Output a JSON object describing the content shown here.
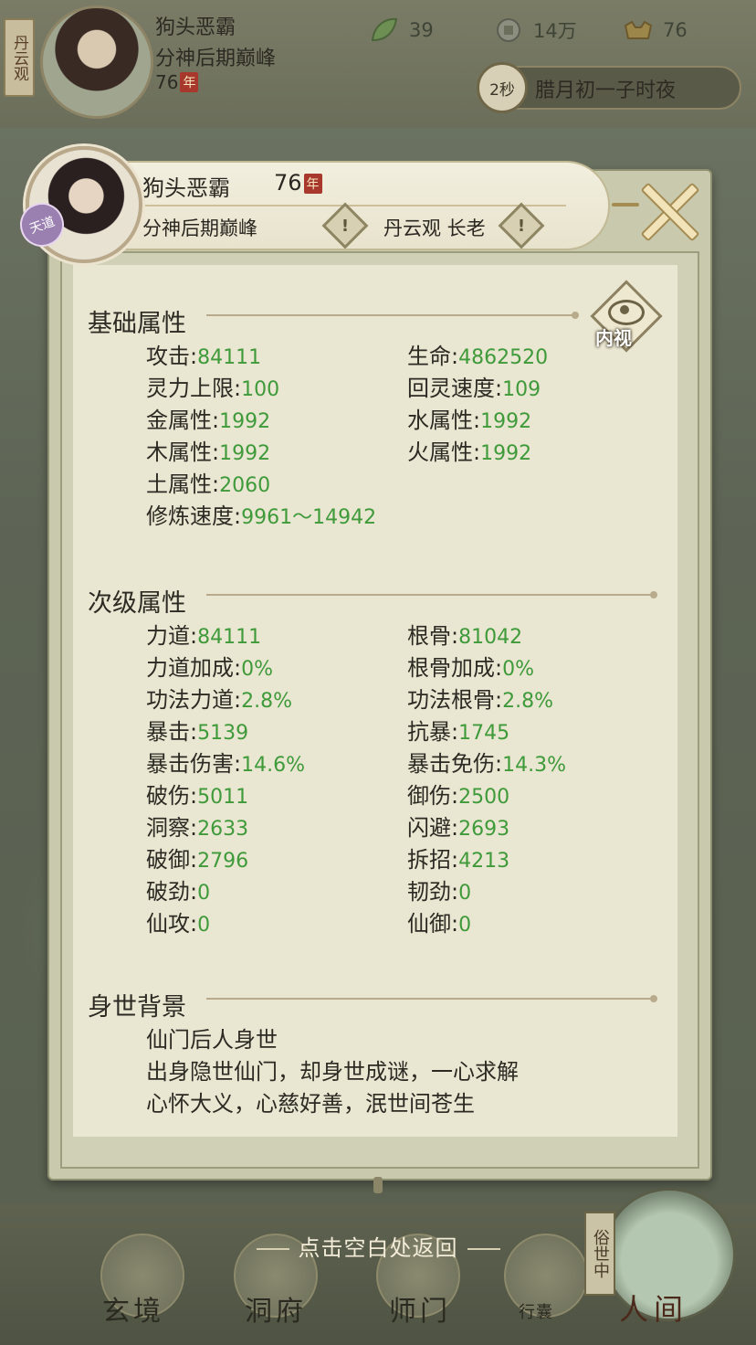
{
  "top": {
    "sect_tag": "丹云观",
    "name": "狗头恶霸",
    "realm": "分神后期巅峰",
    "age": "76",
    "age_unit": "年",
    "resources": {
      "spirit": "39",
      "coins": "14万",
      "strength": "76"
    },
    "timer": "2秒",
    "time_text": "腊月初一子时夜"
  },
  "header": {
    "name": "狗头恶霸",
    "age": "76",
    "age_unit": "年",
    "realm": "分神后期巅峰",
    "sect": "丹云观 长老",
    "avatar_tag": "天道",
    "eye_label": "内视"
  },
  "basic": {
    "title": "基础属性",
    "stats": [
      {
        "label": "攻击:",
        "value": "84111"
      },
      {
        "label": "生命:",
        "value": "4862520"
      },
      {
        "label": "灵力上限:",
        "value": "100"
      },
      {
        "label": "回灵速度:",
        "value": "109"
      },
      {
        "label": "金属性:",
        "value": "1992"
      },
      {
        "label": "水属性:",
        "value": "1992"
      },
      {
        "label": "木属性:",
        "value": "1992"
      },
      {
        "label": "火属性:",
        "value": "1992"
      },
      {
        "label": "土属性:",
        "value": "2060"
      },
      {
        "label": "修炼速度:",
        "value": "9961～14942"
      }
    ]
  },
  "secondary": {
    "title": "次级属性",
    "stats": [
      {
        "label": "力道:",
        "value": "84111"
      },
      {
        "label": "根骨:",
        "value": "81042"
      },
      {
        "label": "力道加成:",
        "value": "0%"
      },
      {
        "label": "根骨加成:",
        "value": "0%"
      },
      {
        "label": "功法力道:",
        "value": "2.8%"
      },
      {
        "label": "功法根骨:",
        "value": "2.8%"
      },
      {
        "label": "暴击:",
        "value": "5139"
      },
      {
        "label": "抗暴:",
        "value": "1745"
      },
      {
        "label": "暴击伤害:",
        "value": "14.6%"
      },
      {
        "label": "暴击免伤:",
        "value": "14.3%"
      },
      {
        "label": "破伤:",
        "value": "5011"
      },
      {
        "label": "御伤:",
        "value": "2500"
      },
      {
        "label": "洞察:",
        "value": "2633"
      },
      {
        "label": "闪避:",
        "value": "2693"
      },
      {
        "label": "破御:",
        "value": "2796"
      },
      {
        "label": "拆招:",
        "value": "4213"
      },
      {
        "label": "破劲:",
        "value": "0"
      },
      {
        "label": "韧劲:",
        "value": "0"
      },
      {
        "label": "仙攻:",
        "value": "0"
      },
      {
        "label": "仙御:",
        "value": "0"
      }
    ]
  },
  "background": {
    "title": "身世背景",
    "lines": [
      "仙门后人身世",
      "出身隐世仙门，却身世成谜，一心求解",
      "心怀大义，心慈好善，泯世间苍生"
    ]
  },
  "hint": "点击空白处返回",
  "nav": {
    "xuanjing": "玄境",
    "dongfu": "洞府",
    "shimen": "师门",
    "xingnang": "行囊",
    "world_tag": "俗世中",
    "world": "人间"
  },
  "colors": {
    "value_green": "#3f9a3a",
    "panel_bg": "#e9e6d2",
    "badge_red": "#a8382c"
  }
}
